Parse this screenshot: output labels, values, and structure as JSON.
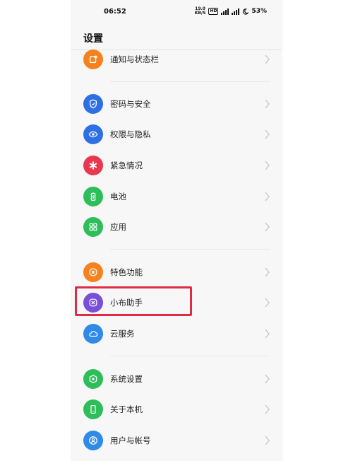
{
  "status_bar": {
    "time": "06:52",
    "net_speed_value": "19.0",
    "net_speed_unit": "KB/S",
    "hd_label": "HD",
    "battery": "53%"
  },
  "page": {
    "title": "设置"
  },
  "settings_items": [
    {
      "id": "notifications",
      "label": "通知与状态栏",
      "icon": "notification-icon",
      "color": "#F5821F"
    },
    {
      "id": "password-security",
      "label": "密码与安全",
      "icon": "shield-icon",
      "color": "#2F6FE4"
    },
    {
      "id": "permissions-privacy",
      "label": "权限与隐私",
      "icon": "eye-icon",
      "color": "#2F6FE4"
    },
    {
      "id": "emergency",
      "label": "紧急情况",
      "icon": "asterisk-icon",
      "color": "#E8384F"
    },
    {
      "id": "battery",
      "label": "电池",
      "icon": "battery-icon",
      "color": "#2DBE5A"
    },
    {
      "id": "apps",
      "label": "应用",
      "icon": "grid-icon",
      "color": "#2DBE5A"
    },
    {
      "id": "special-features",
      "label": "特色功能",
      "icon": "star-icon",
      "color": "#F5821F"
    },
    {
      "id": "xiaobu-assistant",
      "label": "小布助手",
      "icon": "assistant-icon",
      "color": "#7A4FD8"
    },
    {
      "id": "cloud-services",
      "label": "云服务",
      "icon": "cloud-icon",
      "color": "#2F8AE8"
    },
    {
      "id": "system-settings",
      "label": "系统设置",
      "icon": "gear-icon",
      "color": "#2DBE5A"
    },
    {
      "id": "about-phone",
      "label": "关于本机",
      "icon": "phone-icon",
      "color": "#2DBE5A"
    },
    {
      "id": "user-account",
      "label": "用户与帐号",
      "icon": "user-icon",
      "color": "#2F8AE8"
    }
  ],
  "highlight": {
    "target": "xiaobu-assistant",
    "color": "#E02B44"
  }
}
